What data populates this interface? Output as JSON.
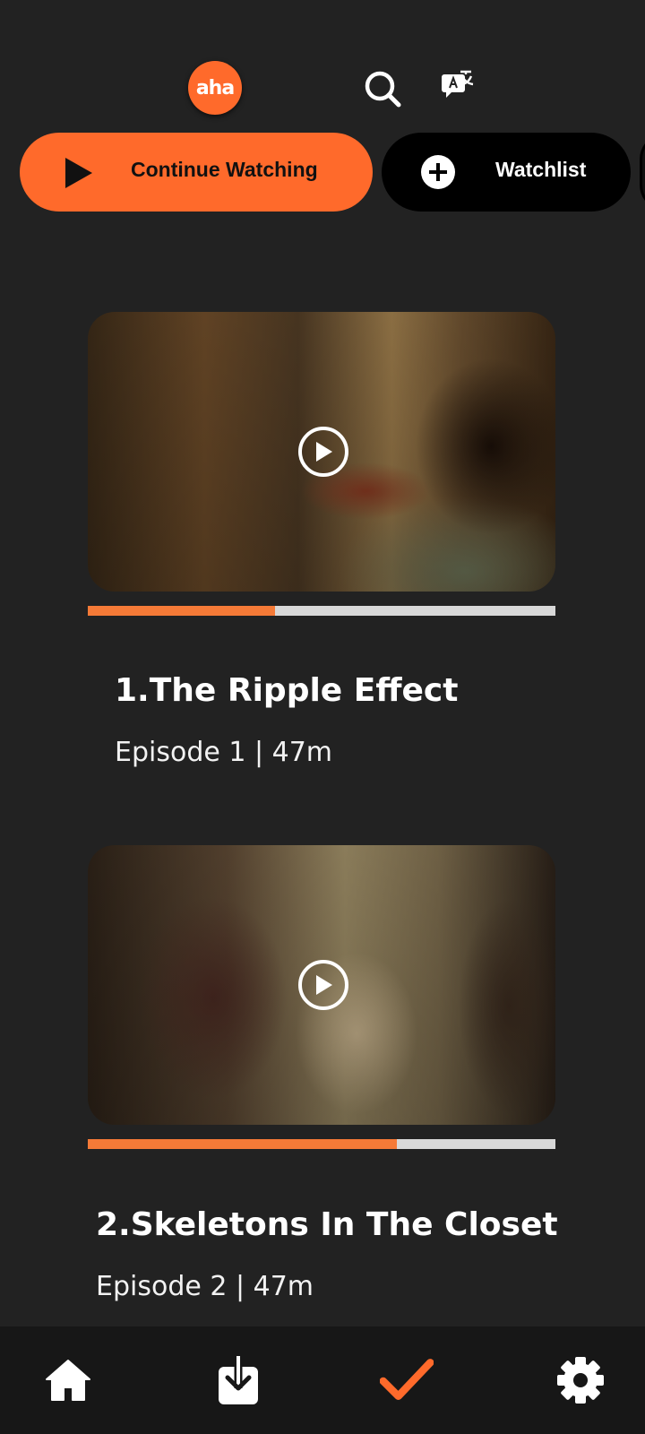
{
  "header": {
    "logo_text": "aha",
    "icons": [
      "search-icon",
      "translate-icon"
    ]
  },
  "actions": {
    "continue_label": "Continue Watching",
    "watchlist_label": "Watchlist"
  },
  "episodes": [
    {
      "title": "1.The Ripple Effect",
      "meta": "Episode 1 | 47m",
      "progress": 0.4
    },
    {
      "title": "2.Skeletons In The Closet",
      "meta": "Episode 2 | 47m",
      "progress": 0.66
    }
  ],
  "bottom_nav": {
    "items": [
      "home-icon",
      "download-icon",
      "watchlist-check-icon",
      "settings-icon"
    ],
    "active": "watchlist-check-icon"
  },
  "colors": {
    "background": "#222222",
    "accent": "#ff6a2b",
    "progress_fill": "#f57a37",
    "progress_track": "#d8d8d8",
    "nav_background": "#171717"
  }
}
